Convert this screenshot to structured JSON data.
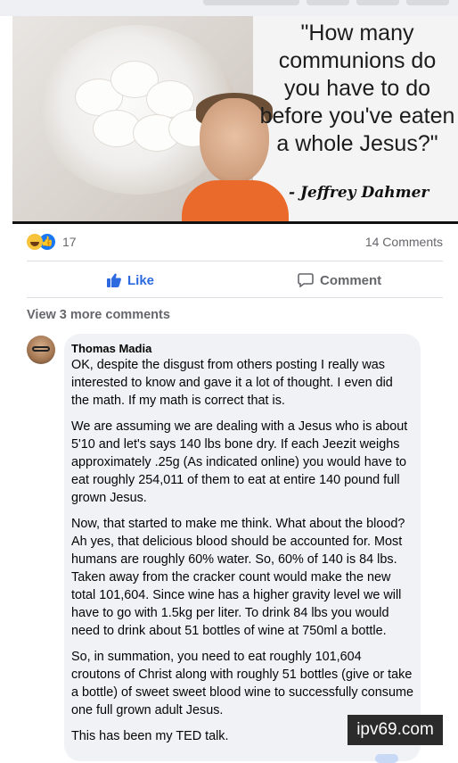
{
  "post": {
    "image": {
      "quote": "\"How many communions do you have to do before you've eaten a whole Jesus?\"",
      "attribution": "- Jeffrey Dahmer"
    },
    "reaction_count": "17",
    "comments_count": "14 Comments",
    "actions": {
      "like": "Like",
      "comment": "Comment"
    },
    "view_more": "View 3 more comments"
  },
  "comment": {
    "author": "Thomas Madia",
    "paragraphs": [
      "OK, despite the disgust from others posting I really was interested to know and gave it a lot of thought. I even did the math. If my math is correct that is.",
      "We are assuming we are dealing with a Jesus who is about 5'10 and let's says 140 lbs bone dry. If each Jeezit weighs approximately .25g (As indicated online) you would have to eat roughly 254,011 of them to eat at entire 140 pound full grown Jesus.",
      "Now, that started to make me think. What about the blood? Ah yes, that delicious blood should be accounted for. Most humans are roughly 60% water. So, 60% of 140 is 84 lbs. Taken away from the cracker count would make the new total 101,604. Since wine has a higher gravity level we will have to go with 1.5kg per liter. To drink 84 lbs you would need to drink about 51 bottles of wine at 750ml a bottle.",
      "So, in summation, you need to eat roughly 101,604 croutons of Christ along with roughly 51 bottles (give or take a bottle) of sweet sweet blood wine to successfully consume one full grown adult Jesus.",
      "This has been my TED talk."
    ]
  },
  "watermark": "ipv69.com",
  "colors": {
    "like_blue": "#2d6ae0",
    "muted_text": "#65676b",
    "bubble_bg": "#f0f2f5"
  }
}
